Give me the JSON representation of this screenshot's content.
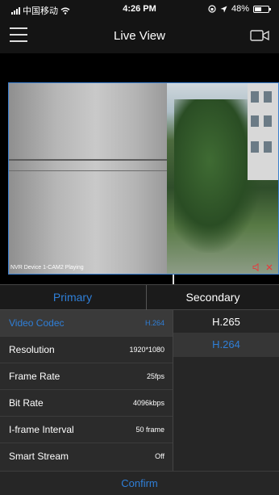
{
  "status_bar": {
    "carrier": "中国移动",
    "time": "4:26 PM",
    "battery_text": "48%",
    "battery_level": 0.48
  },
  "navbar": {
    "title": "Live View"
  },
  "video": {
    "caption": "NVR Device 1-CAM2 Playing"
  },
  "stream_tabs": [
    {
      "label": "Primary",
      "selected": true
    },
    {
      "label": "Secondary",
      "selected": false
    }
  ],
  "settings": [
    {
      "label": "Video Codec",
      "value": "H.264",
      "active": true
    },
    {
      "label": "Resolution",
      "value": "1920*1080",
      "active": false
    },
    {
      "label": "Frame Rate",
      "value": "25fps",
      "active": false
    },
    {
      "label": "Bit Rate",
      "value": "4096kbps",
      "active": false
    },
    {
      "label": "I-frame Interval",
      "value": "50 frame",
      "active": false
    },
    {
      "label": "Smart Stream",
      "value": "Off",
      "active": false
    }
  ],
  "codec_options": [
    {
      "label": "H.265",
      "selected": false
    },
    {
      "label": "H.264",
      "selected": true
    }
  ],
  "confirm_label": "Confirm",
  "colors": {
    "accent": "#2f7fd8",
    "bar_bg": "#141414",
    "panel_bg": "#2b2b2b"
  }
}
